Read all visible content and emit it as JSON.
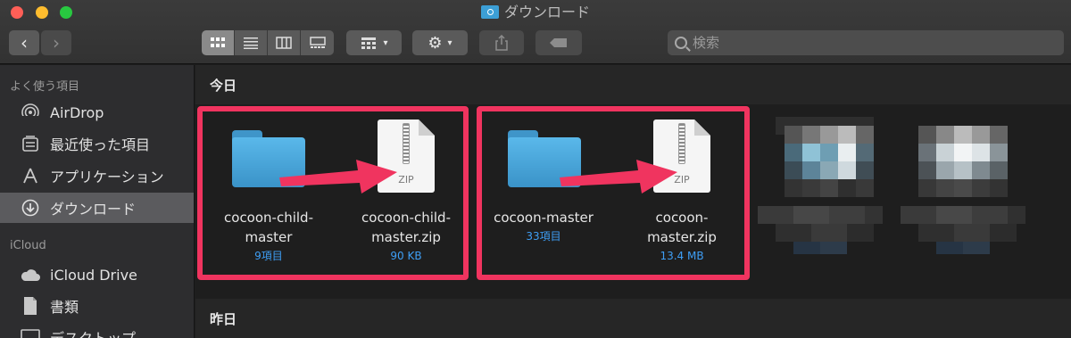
{
  "window": {
    "title": "ダウンロード"
  },
  "search": {
    "placeholder": "検索"
  },
  "sidebar": {
    "favorites_header": "よく使う項目",
    "icloud_header": "iCloud",
    "items": [
      {
        "label": "AirDrop",
        "icon": "airdrop-icon"
      },
      {
        "label": "最近使った項目",
        "icon": "recents-icon"
      },
      {
        "label": "アプリケーション",
        "icon": "applications-icon"
      },
      {
        "label": "ダウンロード",
        "icon": "downloads-icon",
        "selected": true
      },
      {
        "label": "iCloud Drive",
        "icon": "cloud-icon"
      },
      {
        "label": "書類",
        "icon": "documents-icon"
      },
      {
        "label": "デスクトップ",
        "icon": "desktop-icon"
      }
    ]
  },
  "main": {
    "groups": [
      {
        "label": "今日"
      },
      {
        "label": "昨日"
      }
    ],
    "files": [
      {
        "name_line1": "cocoon-child-",
        "name_line2": "master",
        "meta": "9項目",
        "kind": "folder"
      },
      {
        "name_line1": "cocoon-child-",
        "name_line2": "master.zip",
        "meta": "90 KB",
        "kind": "zip",
        "badge": "ZIP"
      },
      {
        "name_line1": "cocoon-master",
        "name_line2": "",
        "meta": "33項目",
        "kind": "folder"
      },
      {
        "name_line1": "cocoon-",
        "name_line2": "master.zip",
        "meta": "13.4 MB",
        "kind": "zip",
        "badge": "ZIP"
      }
    ]
  },
  "colors": {
    "highlight": "#f0345f",
    "arrow": "#f0345f",
    "folder": "#4aa8dd",
    "meta_text": "#3e9ef5",
    "sidebar_selected": "#5b5b5e"
  }
}
